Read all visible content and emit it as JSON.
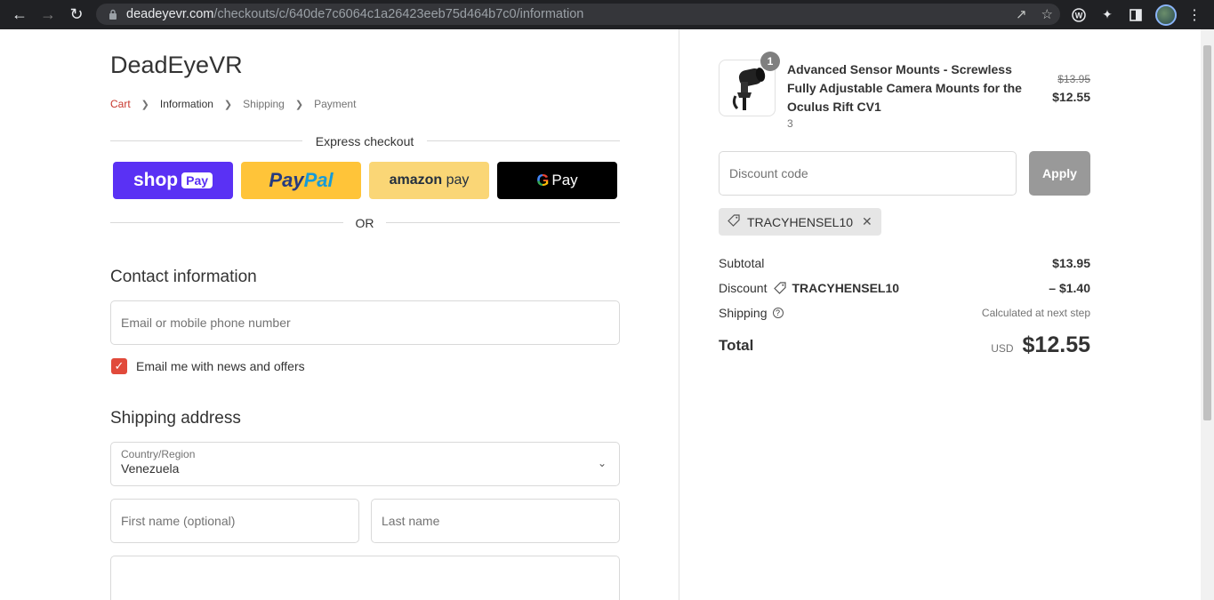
{
  "browser": {
    "url_host": "deadeyevr.com",
    "url_path": "/checkouts/c/640de7c6064c1a26423eeb75d464b7c0/information"
  },
  "store": {
    "name": "DeadEyeVR"
  },
  "breadcrumb": {
    "cart": "Cart",
    "information": "Information",
    "shipping": "Shipping",
    "payment": "Payment"
  },
  "express": {
    "label": "Express checkout",
    "shop_pay": "shop",
    "shop_pay_chip": "Pay",
    "paypal_1": "Pay",
    "paypal_2": "Pal",
    "amazon_1": "amazon",
    "amazon_2": " pay",
    "gpay_g": "G",
    "gpay_label": "Pay",
    "or": "OR"
  },
  "contact": {
    "title": "Contact information",
    "email_placeholder": "Email or mobile phone number",
    "newsletter_label": "Email me with news and offers",
    "newsletter_checked": true
  },
  "shipping": {
    "title": "Shipping address",
    "country_label": "Country/Region",
    "country_value": "Venezuela",
    "first_name_placeholder": "First name (optional)",
    "last_name_placeholder": "Last name"
  },
  "order": {
    "product_name": "Advanced Sensor Mounts - Screwless Fully Adjustable Camera Mounts for the Oculus Rift CV1",
    "variant": "3",
    "quantity": "1",
    "original_price": "$13.95",
    "price": "$12.55",
    "discount_placeholder": "Discount code",
    "apply_label": "Apply",
    "applied_code": "TRACYHENSEL10",
    "subtotal_label": "Subtotal",
    "subtotal": "$13.95",
    "discount_label": "Discount",
    "discount_amount": "– $1.40",
    "shipping_label": "Shipping",
    "shipping_value": "Calculated at next step",
    "total_label": "Total",
    "currency": "USD",
    "total": "$12.55"
  }
}
